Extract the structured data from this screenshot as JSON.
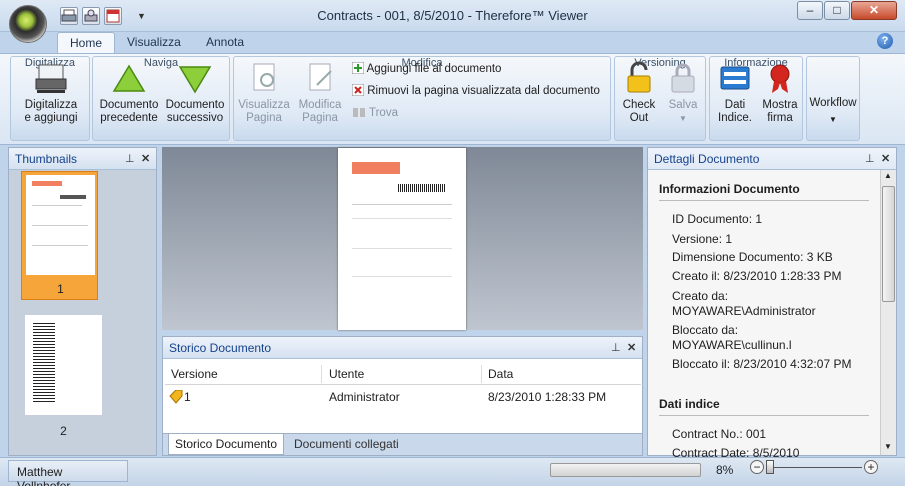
{
  "window": {
    "title": "Contracts - 001, 8/5/2010 - Therefore™ Viewer",
    "minimize": "–",
    "maximize": "□",
    "close": "✕"
  },
  "tabs": [
    {
      "label": "Home"
    },
    {
      "label": "Visualizza"
    },
    {
      "label": "Annota"
    }
  ],
  "help": "?",
  "ribbon": {
    "digitalizza": {
      "button": "Digitalizza\ne aggiungi",
      "label": "Digitalizza"
    },
    "naviga": {
      "prev": "Documento\nprecedente",
      "next": "Documento\nsuccessivo",
      "label": "Naviga"
    },
    "modifica": {
      "view_page": "Visualizza\nPagina",
      "edit_page": "Modifica\nPagina",
      "add_file": "Aggiungi file al documento",
      "remove_page": "Rimuovi la pagina visualizzata dal documento",
      "find": "Trova",
      "label": "Modifica"
    },
    "versioning": {
      "checkout": "Check\nOut",
      "save": "Salva",
      "label": "Versioning"
    },
    "informazione": {
      "index_data": "Dati\nIndice.",
      "show_signature": "Mostra\nfirma",
      "label": "Informazione"
    },
    "workflow": {
      "label": "Workflow"
    }
  },
  "thumbnails": {
    "title": "Thumbnails",
    "pages": [
      "1",
      "2"
    ]
  },
  "history": {
    "title": "Storico Documento",
    "columns": [
      "Versione",
      "Utente",
      "Data"
    ],
    "rows": [
      {
        "version": "1",
        "user": "Administrator",
        "date": "8/23/2010 1:28:33 PM"
      }
    ],
    "tabs": [
      "Storico Documento",
      "Documenti collegati"
    ]
  },
  "details": {
    "title": "Dettagli Documento",
    "info_heading": "Informazioni Documento",
    "info": [
      "ID Documento: 1",
      "Versione: 1",
      "Dimensione Documento: 3 KB",
      "Creato il: 8/23/2010 1:28:33 PM",
      "Creato da:",
      "MOYAWARE\\Administrator",
      "Bloccato da:",
      "MOYAWARE\\cullinun.l",
      "Bloccato il: 8/23/2010 4:32:07 PM"
    ],
    "index_heading": "Dati indice",
    "index": [
      "Contract No.:  001",
      "Contract Date:  8/5/2010"
    ]
  },
  "status": {
    "user": "Matthew Vollnhofer",
    "zoom": "8%",
    "zoom_out": "−",
    "zoom_in": "+"
  },
  "colors": {
    "accent_orange": "#f6a53a",
    "link_blue": "#15428b"
  }
}
